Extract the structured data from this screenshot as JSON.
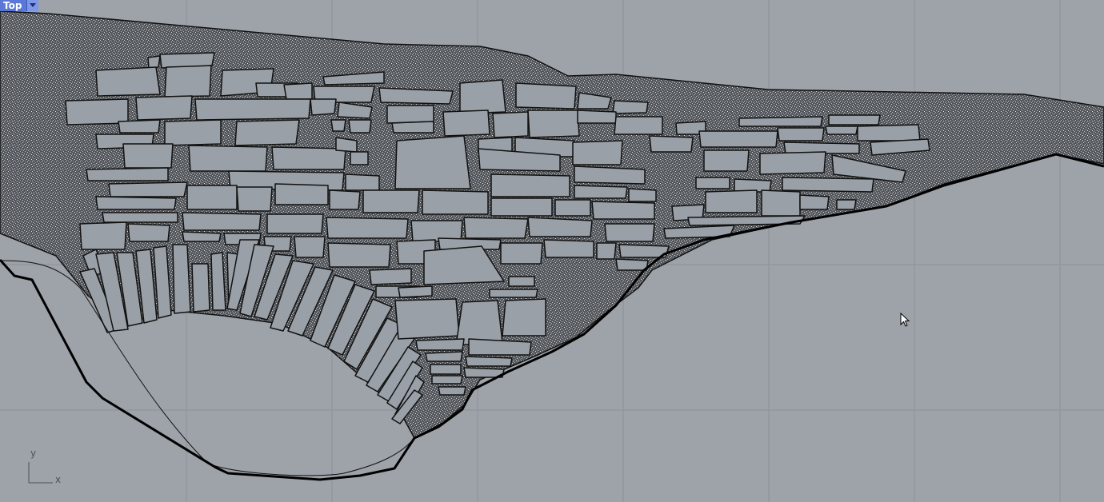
{
  "viewport": {
    "name": "Top",
    "colors": {
      "background": "#9ea3aa",
      "grid": "#8d9299",
      "fill_hatch": "#56595d",
      "stone": "#9aa0a7",
      "outline": "#111111",
      "tab": "#5a78d8"
    }
  },
  "axes": {
    "x_label": "x",
    "y_label": "y"
  },
  "icons": {
    "tab_menu": "chevron-down-icon",
    "cursor": "mouse-pointer-icon"
  }
}
